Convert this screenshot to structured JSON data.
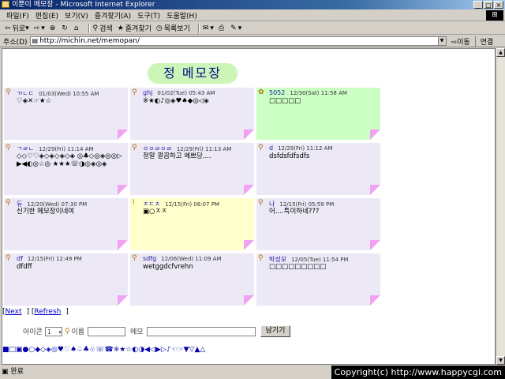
{
  "window": {
    "title": "이뿐이 메모장 - Microsoft Internet Explorer"
  },
  "menu": [
    "파일(F)",
    "편집(E)",
    "보기(V)",
    "즐겨찾기(A)",
    "도구(T)",
    "도움말(H)"
  ],
  "toolbar": {
    "back": "뒤로",
    "search": "검색",
    "favorites": "즐겨찾기",
    "history": "목록보기"
  },
  "address": {
    "label": "주소(D)",
    "url": "http://michin.net/memopan/",
    "go": "이동",
    "links": "연결"
  },
  "page": {
    "title": "정 메모장"
  },
  "memos": [
    {
      "name": "ㄲㄴㄷ",
      "date": "01/03(Wed) 10:55 AM",
      "body": "♡◈✕☞★☆",
      "color": "pink",
      "icon": "magnifier-icon"
    },
    {
      "name": "ghj",
      "date": "01/02(Tue) 05:43 AM",
      "body": "※★◐♪◎◈♥♠◆◎◁◈",
      "color": "pink",
      "icon": "magnifier-icon"
    },
    {
      "name": "5052",
      "date": "12/30(Sat) 11:58 AM",
      "body": "□□□□□",
      "color": "green",
      "icon": "frog-icon"
    },
    {
      "name": "ㄱㄹㄴ",
      "date": "12/29(Fri) 11:14 AM",
      "body": "◇◇♡♡◈◇◈◇◈◇◈ ◎♣◇◎◈◎◎▷▶◀◐◎☆◎ ★★★☏◑◎◈◎◈",
      "color": "pink",
      "icon": "magnifier-icon"
    },
    {
      "name": "ㅇㅇㄹㅇㄹ",
      "date": "12/29(Fri) 11:13 AM",
      "body": "정말 깔끔하고 예쁘당....",
      "color": "pink",
      "icon": "magnifier-icon"
    },
    {
      "name": "d",
      "date": "12/29(Fri) 11:12 AM",
      "body": "dsfdsfdfsdfs",
      "color": "pink",
      "icon": "magnifier-icon"
    },
    {
      "name": "듀",
      "date": "12/20(Wed) 07:30 PM",
      "body": "신기한 메모장이네여",
      "color": "pink",
      "icon": "magnifier-icon"
    },
    {
      "name": "ㅈㄷㅈ",
      "date": "12/15(Fri) 08:07 PM",
      "body": "▣○ㅈㅈ",
      "color": "yellow",
      "icon": "clip-icon"
    },
    {
      "name": "나",
      "date": "12/15(Fri) 05:59 PM",
      "body": "어....특이하네???",
      "color": "pink",
      "icon": "magnifier-icon"
    },
    {
      "name": "df",
      "date": "12/15(Fri) 12:49 PM",
      "body": "dfdff",
      "color": "pink",
      "icon": "magnifier-icon"
    },
    {
      "name": "sdfg",
      "date": "12/06(Wed) 11:09 AM",
      "body": "wetggdcfvrehn",
      "color": "pink",
      "icon": "magnifier-icon"
    },
    {
      "name": "박성모",
      "date": "12/05(Tue) 11:54 PM",
      "body": "□□□□□□□□□",
      "color": "pink",
      "icon": "magnifier-icon"
    }
  ],
  "nav": {
    "next": "Next",
    "refresh": "Refresh"
  },
  "form": {
    "icon_label": "아이콘",
    "icon_value": "1",
    "name_label": "이름",
    "memo_label": "메모",
    "submit": "남기기"
  },
  "icon_palette": "■□▣●○◆◇◈◎♥♡♠♤♣♧☏☎※★☆◐◑◀◁▶▷♪☜☞▼▽▲△",
  "status": {
    "text": "완료",
    "copyright": "Copyright(c) http://www.happycgi.com"
  }
}
